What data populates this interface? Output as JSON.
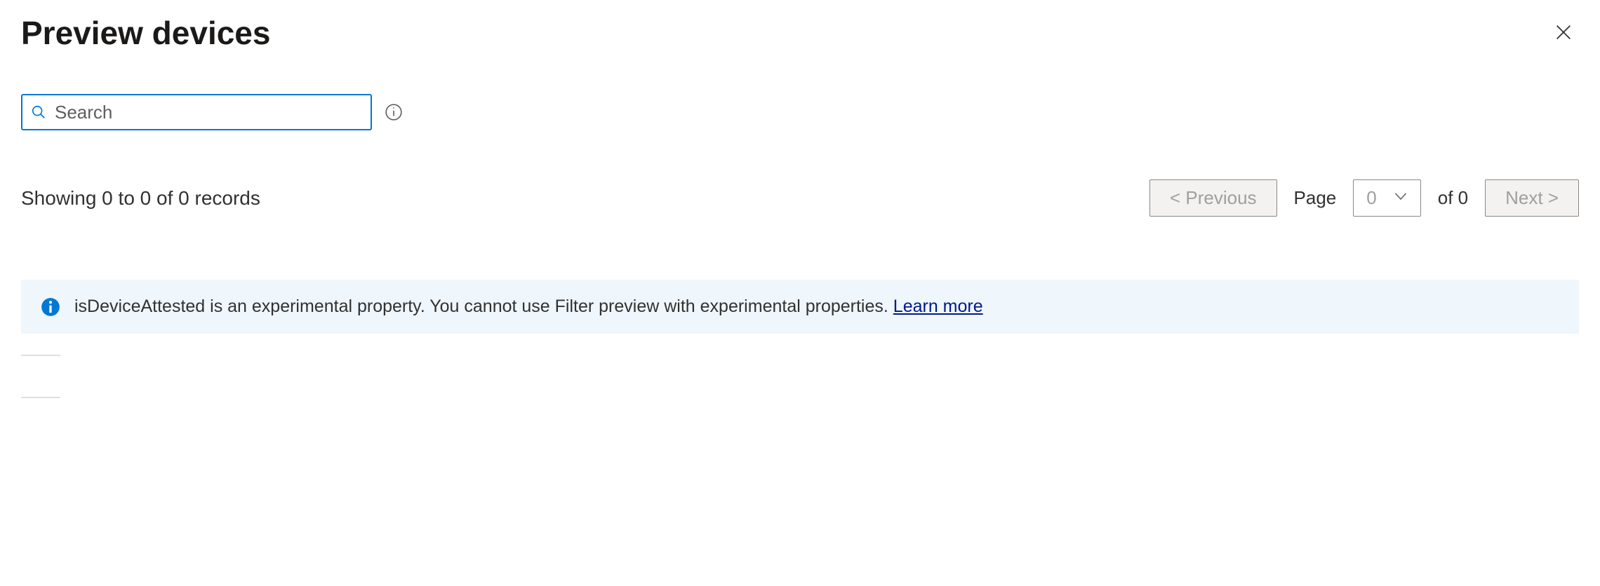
{
  "header": {
    "title": "Preview devices"
  },
  "search": {
    "placeholder": "Search",
    "value": ""
  },
  "records": {
    "summary": "Showing 0 to 0 of 0 records"
  },
  "pagination": {
    "prev_label": "<  Previous",
    "page_label": "Page",
    "current_page": "0",
    "of_label": "of 0",
    "next_label": "Next  >"
  },
  "banner": {
    "message": "isDeviceAttested is an experimental property. You cannot use Filter preview with experimental properties. ",
    "link_label": "Learn more"
  }
}
